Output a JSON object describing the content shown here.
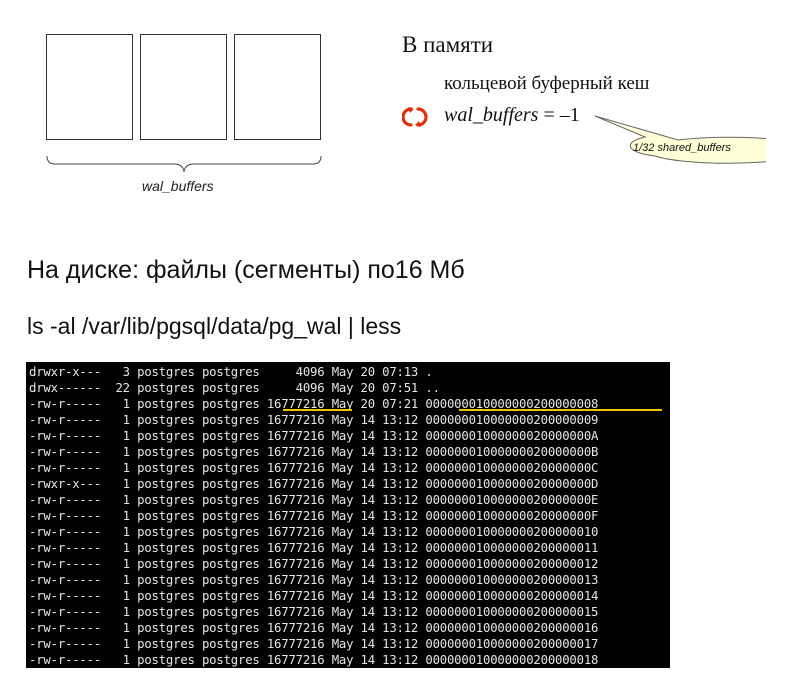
{
  "diagram": {
    "brace_label": "wal_buffers"
  },
  "memory": {
    "title": "В памяти",
    "description": "кольцевой буферный кеш",
    "param_name": "wal_buffers",
    "param_rest": " = –1",
    "callout_text": "1/32 shared_buffers",
    "icon": "reload-icon",
    "icon_color": "#e03010"
  },
  "disk": {
    "title": "На диске: файлы (сегменты) по16 Мб",
    "command": "ls -al /var/lib/pgsql/data/pg_wal | less"
  },
  "terminal": {
    "highlight_color": "#f0c300",
    "rows": [
      {
        "perms": "drwxr-x---",
        "links": " 3",
        "owner": "postgres",
        "group": "postgres",
        "size": "    4096",
        "date": "May 20 07:13",
        "name": "."
      },
      {
        "perms": "drwx------",
        "links": "22",
        "owner": "postgres",
        "group": "postgres",
        "size": "    4096",
        "date": "May 20 07:51",
        "name": ".."
      },
      {
        "perms": "-rw-r-----",
        "links": " 1",
        "owner": "postgres",
        "group": "postgres",
        "size": "16777216",
        "date": "May 20 07:21",
        "name": "000000010000000200000008"
      },
      {
        "perms": "-rw-r-----",
        "links": " 1",
        "owner": "postgres",
        "group": "postgres",
        "size": "16777216",
        "date": "May 14 13:12",
        "name": "000000010000000200000009"
      },
      {
        "perms": "-rw-r-----",
        "links": " 1",
        "owner": "postgres",
        "group": "postgres",
        "size": "16777216",
        "date": "May 14 13:12",
        "name": "00000001000000020000000A"
      },
      {
        "perms": "-rw-r-----",
        "links": " 1",
        "owner": "postgres",
        "group": "postgres",
        "size": "16777216",
        "date": "May 14 13:12",
        "name": "00000001000000020000000B"
      },
      {
        "perms": "-rw-r-----",
        "links": " 1",
        "owner": "postgres",
        "group": "postgres",
        "size": "16777216",
        "date": "May 14 13:12",
        "name": "00000001000000020000000C"
      },
      {
        "perms": "-rwxr-x---",
        "links": " 1",
        "owner": "postgres",
        "group": "postgres",
        "size": "16777216",
        "date": "May 14 13:12",
        "name": "00000001000000020000000D"
      },
      {
        "perms": "-rw-r-----",
        "links": " 1",
        "owner": "postgres",
        "group": "postgres",
        "size": "16777216",
        "date": "May 14 13:12",
        "name": "00000001000000020000000E"
      },
      {
        "perms": "-rw-r-----",
        "links": " 1",
        "owner": "postgres",
        "group": "postgres",
        "size": "16777216",
        "date": "May 14 13:12",
        "name": "00000001000000020000000F"
      },
      {
        "perms": "-rw-r-----",
        "links": " 1",
        "owner": "postgres",
        "group": "postgres",
        "size": "16777216",
        "date": "May 14 13:12",
        "name": "000000010000000200000010"
      },
      {
        "perms": "-rw-r-----",
        "links": " 1",
        "owner": "postgres",
        "group": "postgres",
        "size": "16777216",
        "date": "May 14 13:12",
        "name": "000000010000000200000011"
      },
      {
        "perms": "-rw-r-----",
        "links": " 1",
        "owner": "postgres",
        "group": "postgres",
        "size": "16777216",
        "date": "May 14 13:12",
        "name": "000000010000000200000012"
      },
      {
        "perms": "-rw-r-----",
        "links": " 1",
        "owner": "postgres",
        "group": "postgres",
        "size": "16777216",
        "date": "May 14 13:12",
        "name": "000000010000000200000013"
      },
      {
        "perms": "-rw-r-----",
        "links": " 1",
        "owner": "postgres",
        "group": "postgres",
        "size": "16777216",
        "date": "May 14 13:12",
        "name": "000000010000000200000014"
      },
      {
        "perms": "-rw-r-----",
        "links": " 1",
        "owner": "postgres",
        "group": "postgres",
        "size": "16777216",
        "date": "May 14 13:12",
        "name": "000000010000000200000015"
      },
      {
        "perms": "-rw-r-----",
        "links": " 1",
        "owner": "postgres",
        "group": "postgres",
        "size": "16777216",
        "date": "May 14 13:12",
        "name": "000000010000000200000016"
      },
      {
        "perms": "-rw-r-----",
        "links": " 1",
        "owner": "postgres",
        "group": "postgres",
        "size": "16777216",
        "date": "May 14 13:12",
        "name": "000000010000000200000017"
      },
      {
        "perms": "-rw-r-----",
        "links": " 1",
        "owner": "postgres",
        "group": "postgres",
        "size": "16777216",
        "date": "May 14 13:12",
        "name": "000000010000000200000018"
      }
    ]
  }
}
